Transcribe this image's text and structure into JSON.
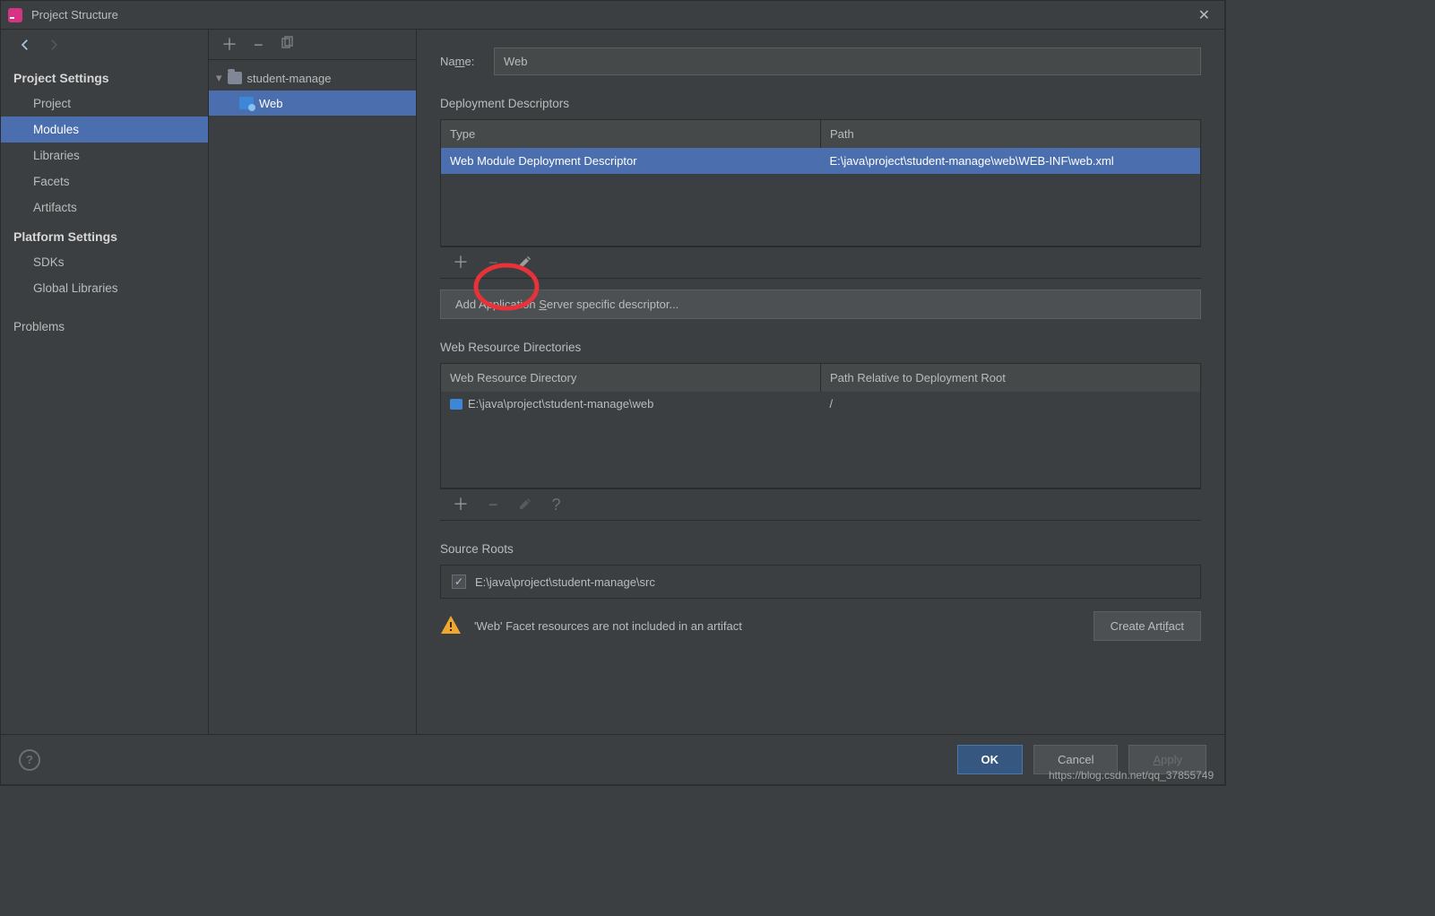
{
  "titlebar": {
    "title": "Project Structure"
  },
  "nav": {
    "back_enabled": true,
    "section1": "Project Settings",
    "items1": [
      "Project",
      "Modules",
      "Libraries",
      "Facets",
      "Artifacts"
    ],
    "selected1": "Modules",
    "section2": "Platform Settings",
    "items2": [
      "SDKs",
      "Global Libraries"
    ],
    "section3_item": "Problems"
  },
  "tree": {
    "root": "student-manage",
    "child": "Web"
  },
  "main": {
    "name_label": "Name:",
    "name_value": "Web",
    "deploy_title": "Deployment Descriptors",
    "deploy_headers": [
      "Type",
      "Path"
    ],
    "deploy_row": {
      "type": "Web Module Deployment Descriptor",
      "path": "E:\\java\\project\\student-manage\\web\\WEB-INF\\web.xml"
    },
    "add_server_btn": "Add Application Server specific descriptor...",
    "wr_title": "Web Resource Directories",
    "wr_headers": [
      "Web Resource Directory",
      "Path Relative to Deployment Root"
    ],
    "wr_row": {
      "dir": "E:\\java\\project\\student-manage\\web",
      "rel": "/"
    },
    "source_title": "Source Roots",
    "source_item": "E:\\java\\project\\student-manage\\src",
    "warn_text": "'Web' Facet resources are not included in an artifact",
    "create_artifact": "Create Artifact"
  },
  "footer": {
    "ok": "OK",
    "cancel": "Cancel",
    "apply": "Apply"
  },
  "watermark": "https://blog.csdn.net/qq_37855749"
}
